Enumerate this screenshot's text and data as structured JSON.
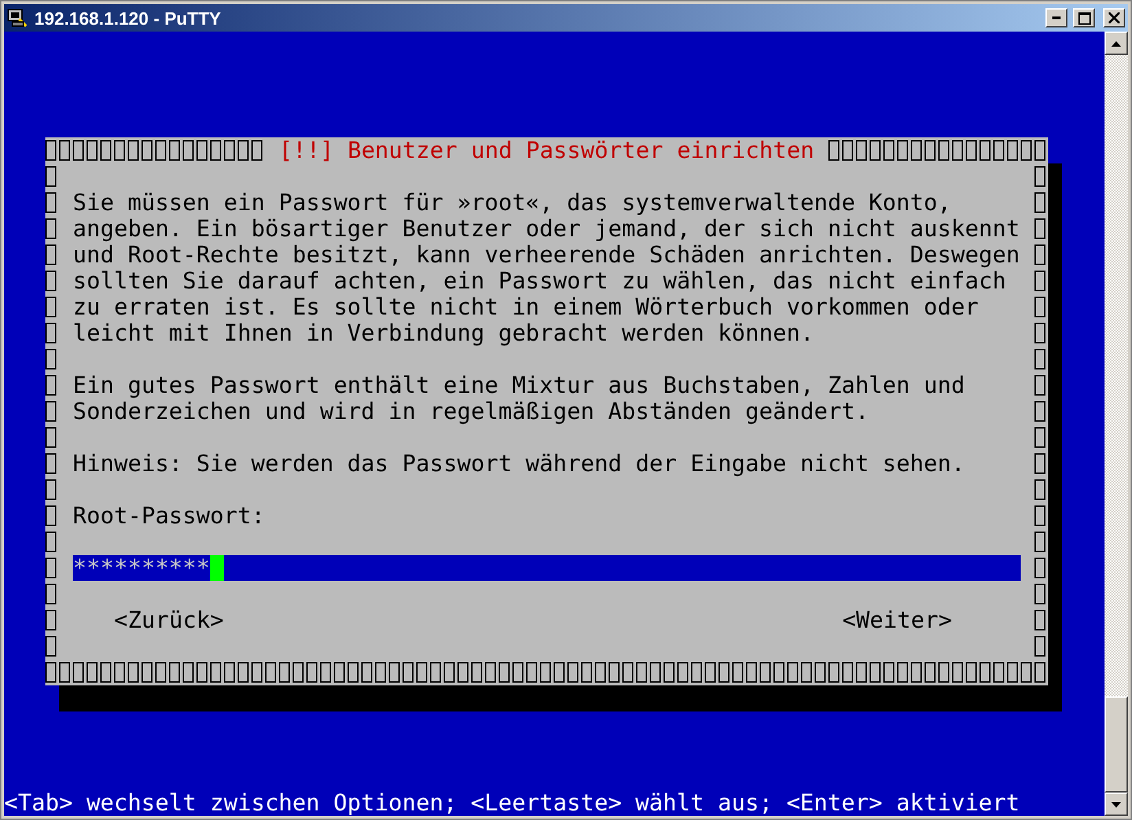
{
  "window": {
    "title": "192.168.1.120 - PuTTY"
  },
  "dialog": {
    "title": "[!!] Benutzer und Passwörter einrichten",
    "paragraphs": [
      [
        "Sie müssen ein Passwort für »root«, das systemverwaltende Konto,",
        "angeben. Ein bösartiger Benutzer oder jemand, der sich nicht auskennt",
        "und Root-Rechte besitzt, kann verheerende Schäden anrichten. Deswegen",
        "sollten Sie darauf achten, ein Passwort zu wählen, das nicht einfach",
        "zu erraten ist. Es sollte nicht in einem Wörterbuch vorkommen oder",
        "leicht mit Ihnen in Verbindung gebracht werden können."
      ],
      [
        "Ein gutes Passwort enthält eine Mixtur aus Buchstaben, Zahlen und",
        "Sonderzeichen und wird in regelmäßigen Abständen geändert."
      ],
      [
        "Hinweis: Sie werden das Passwort während der Eingabe nicht sehen."
      ]
    ],
    "field_label": "Root-Passwort:",
    "password": {
      "value": "**********",
      "focused": true
    },
    "buttons": [
      {
        "label": "<Zurück>"
      },
      {
        "label": "<Weiter>"
      }
    ]
  },
  "help_line": "<Tab> wechselt zwischen Optionen; <Leertaste> wählt aus; <Enter> aktiviert"
}
